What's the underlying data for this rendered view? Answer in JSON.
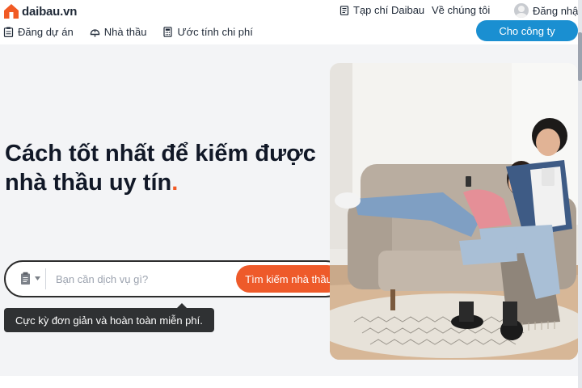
{
  "brand": {
    "name": "daibau.vn",
    "accent": "#f15a24",
    "primary_blue": "#1a8fd1",
    "logo_icon": "house-icon"
  },
  "header": {
    "top_links": [
      {
        "label": "Tạp chí Daibau",
        "icon": "magazine-icon"
      },
      {
        "label": "Về chúng tôi"
      },
      {
        "label": "Đăng nhập",
        "icon": "avatar"
      }
    ],
    "nav": [
      {
        "label": "Đăng dự án",
        "icon": "clipboard-icon"
      },
      {
        "label": "Nhà thầu",
        "icon": "helmet-icon"
      },
      {
        "label": "Ước tính chi phí",
        "icon": "calculator-icon"
      }
    ],
    "cta_label": "Cho công ty"
  },
  "hero": {
    "title_line1": "Cách tốt nhất để kiếm được",
    "title_line2": "nhà thầu uy tín",
    "title_dot": ".",
    "search": {
      "placeholder": "Bạn cần dịch vụ gì?",
      "value": "",
      "button_label": "Tìm kiếm nhà thầu",
      "category_icon": "document-icon"
    },
    "tooltip": "Cực kỳ đơn giản và hoàn toàn miễn phí."
  }
}
